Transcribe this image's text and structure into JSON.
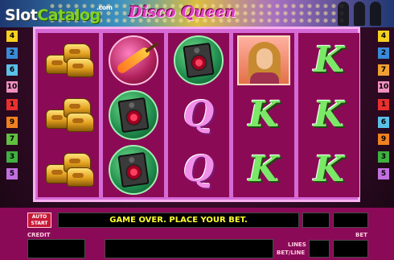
{
  "watermark": {
    "slot": "Slot",
    "catalog": "Catalog",
    "com": ".com"
  },
  "game_title": "Disco Queen",
  "paylines_left": [
    {
      "n": "4",
      "color": "#f5d020"
    },
    {
      "n": "2",
      "color": "#3a8ad8"
    },
    {
      "n": "6",
      "color": "#5ac0e8"
    },
    {
      "n": "10",
      "color": "#f090c0"
    },
    {
      "n": "1",
      "color": "#e83030"
    },
    {
      "n": "9",
      "color": "#f08020"
    },
    {
      "n": "7",
      "color": "#60c040"
    },
    {
      "n": "3",
      "color": "#40b040"
    },
    {
      "n": "5",
      "color": "#c070e0"
    }
  ],
  "paylines_right": [
    {
      "n": "4",
      "color": "#f5d020"
    },
    {
      "n": "2",
      "color": "#3a8ad8"
    },
    {
      "n": "7",
      "color": "#f0a030"
    },
    {
      "n": "10",
      "color": "#f090c0"
    },
    {
      "n": "1",
      "color": "#e83030"
    },
    {
      "n": "6",
      "color": "#5ac0e8"
    },
    {
      "n": "9",
      "color": "#f08020"
    },
    {
      "n": "3",
      "color": "#40b040"
    },
    {
      "n": "5",
      "color": "#c070e0"
    }
  ],
  "reels": [
    [
      "gold-shoes",
      "gold-shoes",
      "gold-shoes"
    ],
    [
      "guitar",
      "speaker",
      "speaker"
    ],
    [
      "speaker",
      "Q",
      "Q"
    ],
    [
      "queen",
      "K",
      "K"
    ],
    [
      "K",
      "K",
      "K"
    ]
  ],
  "symbol_letters": {
    "K": "K",
    "Q": "Q"
  },
  "controls": {
    "auto_start_line1": "AUTO",
    "auto_start_line2": "START",
    "message": "GAME OVER. PLACE YOUR BET.",
    "credit_label": "CREDIT",
    "lines_label": "LINES",
    "bet_per_line_label": "BET/LINE",
    "bet_label": "BET"
  }
}
